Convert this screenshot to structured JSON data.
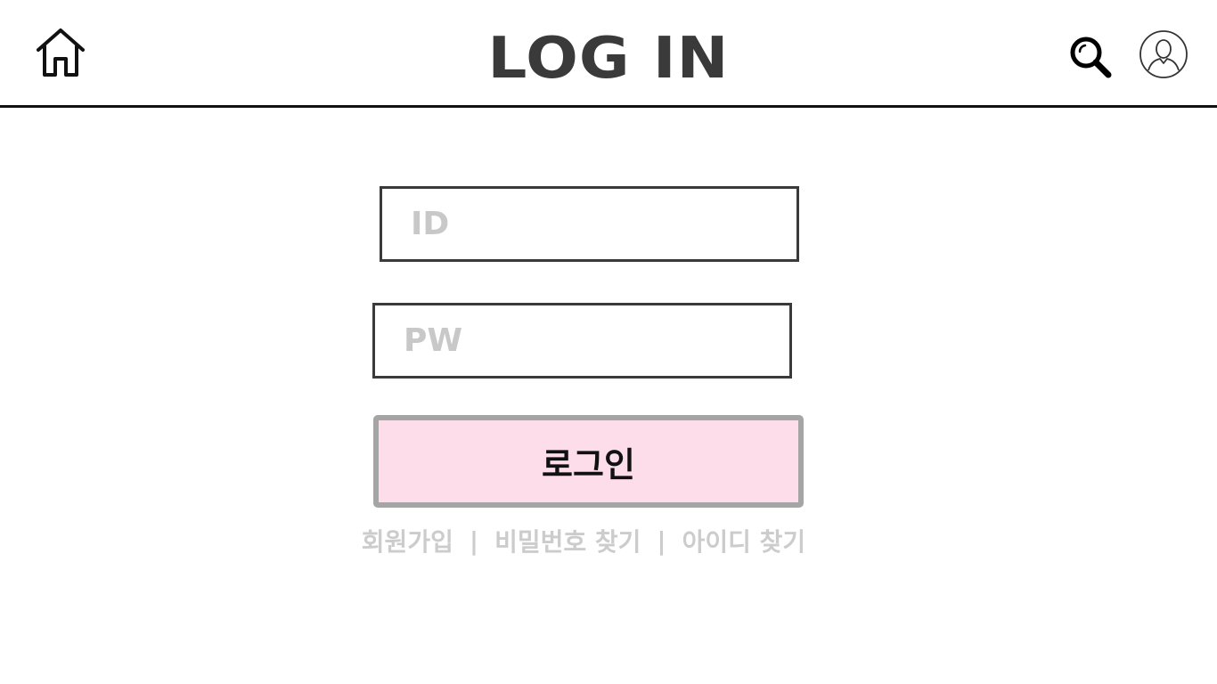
{
  "header": {
    "title": "LOG IN",
    "icons": [
      "home-icon",
      "search-icon",
      "user-icon"
    ]
  },
  "form": {
    "id_placeholder": "ID",
    "id_value": "",
    "pw_placeholder": "PW",
    "pw_value": "",
    "login_label": "로그인"
  },
  "links": {
    "signup": "회원가입",
    "find_password": "비밀번호 찾기",
    "find_id": "아이디 찾기",
    "separator": "|"
  },
  "colors": {
    "title": "#3a3a3a",
    "button_bg": "#fddde9",
    "button_border": "#a5a5a5",
    "link_text": "#cccccc",
    "placeholder": "#c8c8c8"
  }
}
